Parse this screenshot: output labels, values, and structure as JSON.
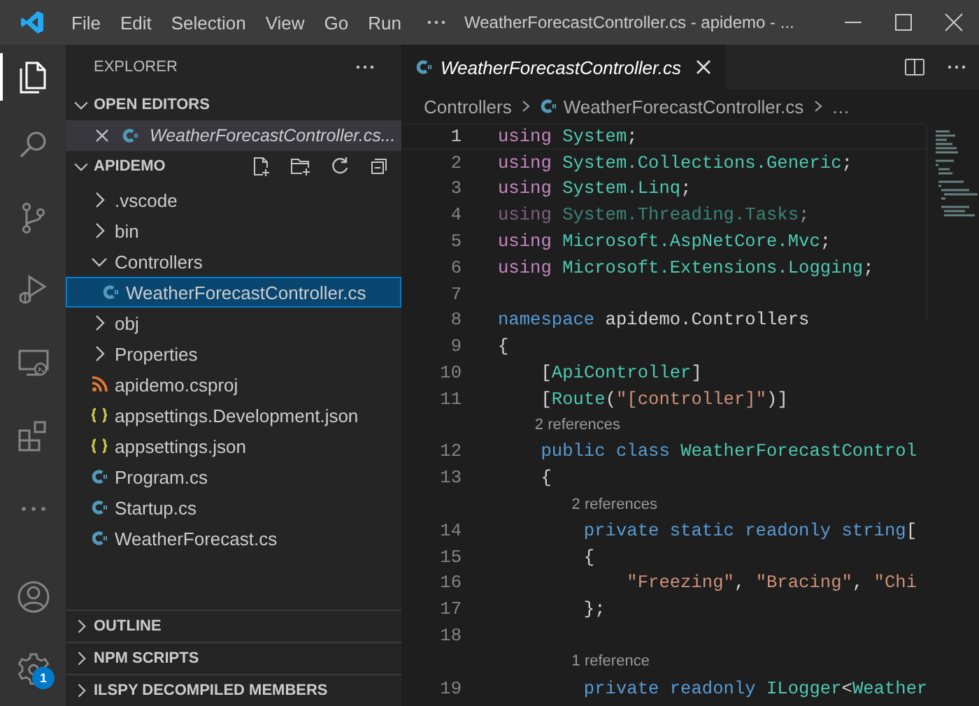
{
  "title_bar": {
    "menu": [
      "File",
      "Edit",
      "Selection",
      "View",
      "Go",
      "Run"
    ],
    "title": "WeatherForecastController.cs - apidemo - ..."
  },
  "activity_bar": {
    "items": [
      {
        "kind": "files",
        "selected": true
      },
      {
        "kind": "search",
        "selected": false
      },
      {
        "kind": "source-control",
        "selected": false
      },
      {
        "kind": "debug",
        "selected": false
      },
      {
        "kind": "remote",
        "selected": false
      },
      {
        "kind": "extensions",
        "selected": false
      },
      {
        "kind": "more",
        "selected": false
      }
    ],
    "bottom_items": [
      {
        "kind": "account",
        "selected": false
      },
      {
        "kind": "settings",
        "selected": false,
        "badge": "1"
      }
    ]
  },
  "sidebar": {
    "title": "EXPLORER",
    "open_editors": {
      "title": "OPEN EDITORS",
      "expanded": true,
      "items": [
        {
          "label": "WeatherForecastController.cs...",
          "kind": "cs",
          "selected": true,
          "preview": true
        }
      ]
    },
    "project": {
      "title": "APIDEMO",
      "expanded": true,
      "tree": [
        {
          "label": ".vscode",
          "kind": "folder",
          "expanded": false,
          "selected": false
        },
        {
          "label": "bin",
          "kind": "folder",
          "expanded": false,
          "selected": false
        },
        {
          "label": "Controllers",
          "kind": "folder",
          "expanded": true,
          "selected": false,
          "children": [
            {
              "label": "WeatherForecastController.cs",
              "kind": "cs",
              "selected": true
            }
          ]
        },
        {
          "label": "obj",
          "kind": "folder",
          "expanded": false,
          "selected": false
        },
        {
          "label": "Properties",
          "kind": "folder",
          "expanded": false,
          "selected": false
        },
        {
          "label": "apidemo.csproj",
          "kind": "rss",
          "selected": false
        },
        {
          "label": "appsettings.Development.json",
          "kind": "json",
          "selected": false
        },
        {
          "label": "appsettings.json",
          "kind": "json",
          "selected": false
        },
        {
          "label": "Program.cs",
          "kind": "cs",
          "selected": false
        },
        {
          "label": "Startup.cs",
          "kind": "cs",
          "selected": false
        },
        {
          "label": "WeatherForecast.cs",
          "kind": "cs",
          "selected": false
        }
      ]
    },
    "panes": [
      {
        "title": "OUTLINE",
        "expanded": false
      },
      {
        "title": "NPM SCRIPTS",
        "expanded": false
      },
      {
        "title": "ILSPY DECOMPILED MEMBERS",
        "expanded": false
      }
    ]
  },
  "editor": {
    "tabs": [
      {
        "label": "WeatherForecastController.cs",
        "kind": "cs",
        "selected": true,
        "preview": true
      }
    ],
    "breadcrumb": [
      {
        "label": "Controllers",
        "kind": "folder"
      },
      {
        "label": "WeatherForecastController.cs",
        "kind": "cs"
      },
      {
        "label": "…",
        "kind": "more"
      }
    ],
    "lines": [
      {
        "kind": "code",
        "number": "1",
        "current": true,
        "unused": false,
        "tokens": [
          {
            "kind": "control",
            "text": "using"
          },
          {
            "kind": "type",
            "text": " System"
          },
          {
            "kind": "plain",
            "text": ";"
          }
        ]
      },
      {
        "kind": "code",
        "number": "2",
        "current": false,
        "unused": false,
        "tokens": [
          {
            "kind": "control",
            "text": "using"
          },
          {
            "kind": "type",
            "text": " System.Collections.Generic"
          },
          {
            "kind": "plain",
            "text": ";"
          }
        ]
      },
      {
        "kind": "code",
        "number": "3",
        "current": false,
        "unused": false,
        "tokens": [
          {
            "kind": "control",
            "text": "using"
          },
          {
            "kind": "type",
            "text": " System.Linq"
          },
          {
            "kind": "plain",
            "text": ";"
          }
        ]
      },
      {
        "kind": "code",
        "number": "4",
        "current": false,
        "unused": true,
        "tokens": [
          {
            "kind": "control",
            "text": "using"
          },
          {
            "kind": "type",
            "text": " System.Threading.Tasks"
          },
          {
            "kind": "plain",
            "text": ";"
          }
        ]
      },
      {
        "kind": "code",
        "number": "5",
        "current": false,
        "unused": false,
        "tokens": [
          {
            "kind": "control",
            "text": "using"
          },
          {
            "kind": "type",
            "text": " Microsoft.AspNetCore.Mvc"
          },
          {
            "kind": "plain",
            "text": ";"
          }
        ]
      },
      {
        "kind": "code",
        "number": "6",
        "current": false,
        "unused": false,
        "tokens": [
          {
            "kind": "control",
            "text": "using"
          },
          {
            "kind": "type",
            "text": " Microsoft.Extensions.Logging"
          },
          {
            "kind": "plain",
            "text": ";"
          }
        ]
      },
      {
        "kind": "code",
        "number": "7",
        "current": false
      },
      {
        "kind": "code",
        "number": "8",
        "current": false,
        "unused": false,
        "tokens": [
          {
            "kind": "keyword",
            "text": "namespace"
          },
          {
            "kind": "plain",
            "text": " apidemo.Controllers"
          }
        ]
      },
      {
        "kind": "code",
        "number": "9",
        "current": false,
        "unused": false,
        "tokens": [
          {
            "kind": "plain",
            "text": "{"
          }
        ]
      },
      {
        "kind": "code",
        "number": "10",
        "current": false,
        "unused": false,
        "tokens": [
          {
            "kind": "plain",
            "text": "    ["
          },
          {
            "kind": "type",
            "text": "ApiController"
          },
          {
            "kind": "plain",
            "text": "]"
          }
        ]
      },
      {
        "kind": "code",
        "number": "11",
        "current": false,
        "unused": false,
        "tokens": [
          {
            "kind": "plain",
            "text": "    ["
          },
          {
            "kind": "type",
            "text": "Route"
          },
          {
            "kind": "plain",
            "text": "("
          },
          {
            "kind": "string",
            "text": "\"[controller]\""
          },
          {
            "kind": "plain",
            "text": ")]"
          }
        ]
      },
      {
        "kind": "codelens",
        "text": "2 references"
      },
      {
        "kind": "code",
        "number": "12",
        "current": false,
        "unused": false,
        "tokens": [
          {
            "kind": "keyword",
            "text": "    public class "
          },
          {
            "kind": "type",
            "text": "WeatherForecastControl"
          }
        ]
      },
      {
        "kind": "code",
        "number": "13",
        "current": false,
        "unused": false,
        "tokens": [
          {
            "kind": "plain",
            "text": "    {"
          }
        ]
      },
      {
        "kind": "codelens",
        "text": "2 references"
      },
      {
        "kind": "code",
        "number": "14",
        "current": false,
        "unused": false,
        "tokens": [
          {
            "kind": "keyword",
            "text": "        private static readonly string"
          },
          {
            "kind": "plain",
            "text": "["
          }
        ]
      },
      {
        "kind": "code",
        "number": "15",
        "current": false,
        "unused": false,
        "tokens": [
          {
            "kind": "plain",
            "text": "        {"
          }
        ]
      },
      {
        "kind": "code",
        "number": "16",
        "current": false,
        "unused": false,
        "tokens": [
          {
            "kind": "string",
            "text": "            \"Freezing\""
          },
          {
            "kind": "plain",
            "text": ", "
          },
          {
            "kind": "string",
            "text": "\"Bracing\""
          },
          {
            "kind": "plain",
            "text": ", "
          },
          {
            "kind": "string",
            "text": "\"Chi"
          }
        ]
      },
      {
        "kind": "code",
        "number": "17",
        "current": false,
        "unused": false,
        "tokens": [
          {
            "kind": "plain",
            "text": "        };"
          }
        ]
      },
      {
        "kind": "code",
        "number": "18",
        "current": false
      },
      {
        "kind": "codelens",
        "text": "1 reference"
      },
      {
        "kind": "code",
        "number": "19",
        "current": false,
        "unused": false,
        "tokens": [
          {
            "kind": "keyword",
            "text": "        private readonly "
          },
          {
            "kind": "type",
            "text": "ILogger"
          },
          {
            "kind": "plain",
            "text": "<"
          },
          {
            "kind": "type",
            "text": "Weather"
          }
        ]
      }
    ]
  }
}
